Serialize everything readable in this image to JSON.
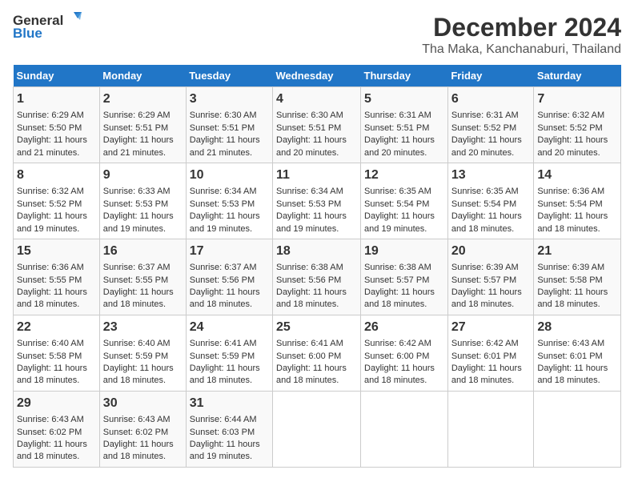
{
  "logo": {
    "line1": "General",
    "line2": "Blue"
  },
  "title": "December 2024",
  "subtitle": "Tha Maka, Kanchanaburi, Thailand",
  "headers": [
    "Sunday",
    "Monday",
    "Tuesday",
    "Wednesday",
    "Thursday",
    "Friday",
    "Saturday"
  ],
  "weeks": [
    [
      {
        "day": "1",
        "sunrise": "Sunrise: 6:29 AM",
        "sunset": "Sunset: 5:50 PM",
        "daylight": "Daylight: 11 hours and 21 minutes."
      },
      {
        "day": "2",
        "sunrise": "Sunrise: 6:29 AM",
        "sunset": "Sunset: 5:51 PM",
        "daylight": "Daylight: 11 hours and 21 minutes."
      },
      {
        "day": "3",
        "sunrise": "Sunrise: 6:30 AM",
        "sunset": "Sunset: 5:51 PM",
        "daylight": "Daylight: 11 hours and 21 minutes."
      },
      {
        "day": "4",
        "sunrise": "Sunrise: 6:30 AM",
        "sunset": "Sunset: 5:51 PM",
        "daylight": "Daylight: 11 hours and 20 minutes."
      },
      {
        "day": "5",
        "sunrise": "Sunrise: 6:31 AM",
        "sunset": "Sunset: 5:51 PM",
        "daylight": "Daylight: 11 hours and 20 minutes."
      },
      {
        "day": "6",
        "sunrise": "Sunrise: 6:31 AM",
        "sunset": "Sunset: 5:52 PM",
        "daylight": "Daylight: 11 hours and 20 minutes."
      },
      {
        "day": "7",
        "sunrise": "Sunrise: 6:32 AM",
        "sunset": "Sunset: 5:52 PM",
        "daylight": "Daylight: 11 hours and 20 minutes."
      }
    ],
    [
      {
        "day": "8",
        "sunrise": "Sunrise: 6:32 AM",
        "sunset": "Sunset: 5:52 PM",
        "daylight": "Daylight: 11 hours and 19 minutes."
      },
      {
        "day": "9",
        "sunrise": "Sunrise: 6:33 AM",
        "sunset": "Sunset: 5:53 PM",
        "daylight": "Daylight: 11 hours and 19 minutes."
      },
      {
        "day": "10",
        "sunrise": "Sunrise: 6:34 AM",
        "sunset": "Sunset: 5:53 PM",
        "daylight": "Daylight: 11 hours and 19 minutes."
      },
      {
        "day": "11",
        "sunrise": "Sunrise: 6:34 AM",
        "sunset": "Sunset: 5:53 PM",
        "daylight": "Daylight: 11 hours and 19 minutes."
      },
      {
        "day": "12",
        "sunrise": "Sunrise: 6:35 AM",
        "sunset": "Sunset: 5:54 PM",
        "daylight": "Daylight: 11 hours and 19 minutes."
      },
      {
        "day": "13",
        "sunrise": "Sunrise: 6:35 AM",
        "sunset": "Sunset: 5:54 PM",
        "daylight": "Daylight: 11 hours and 18 minutes."
      },
      {
        "day": "14",
        "sunrise": "Sunrise: 6:36 AM",
        "sunset": "Sunset: 5:54 PM",
        "daylight": "Daylight: 11 hours and 18 minutes."
      }
    ],
    [
      {
        "day": "15",
        "sunrise": "Sunrise: 6:36 AM",
        "sunset": "Sunset: 5:55 PM",
        "daylight": "Daylight: 11 hours and 18 minutes."
      },
      {
        "day": "16",
        "sunrise": "Sunrise: 6:37 AM",
        "sunset": "Sunset: 5:55 PM",
        "daylight": "Daylight: 11 hours and 18 minutes."
      },
      {
        "day": "17",
        "sunrise": "Sunrise: 6:37 AM",
        "sunset": "Sunset: 5:56 PM",
        "daylight": "Daylight: 11 hours and 18 minutes."
      },
      {
        "day": "18",
        "sunrise": "Sunrise: 6:38 AM",
        "sunset": "Sunset: 5:56 PM",
        "daylight": "Daylight: 11 hours and 18 minutes."
      },
      {
        "day": "19",
        "sunrise": "Sunrise: 6:38 AM",
        "sunset": "Sunset: 5:57 PM",
        "daylight": "Daylight: 11 hours and 18 minutes."
      },
      {
        "day": "20",
        "sunrise": "Sunrise: 6:39 AM",
        "sunset": "Sunset: 5:57 PM",
        "daylight": "Daylight: 11 hours and 18 minutes."
      },
      {
        "day": "21",
        "sunrise": "Sunrise: 6:39 AM",
        "sunset": "Sunset: 5:58 PM",
        "daylight": "Daylight: 11 hours and 18 minutes."
      }
    ],
    [
      {
        "day": "22",
        "sunrise": "Sunrise: 6:40 AM",
        "sunset": "Sunset: 5:58 PM",
        "daylight": "Daylight: 11 hours and 18 minutes."
      },
      {
        "day": "23",
        "sunrise": "Sunrise: 6:40 AM",
        "sunset": "Sunset: 5:59 PM",
        "daylight": "Daylight: 11 hours and 18 minutes."
      },
      {
        "day": "24",
        "sunrise": "Sunrise: 6:41 AM",
        "sunset": "Sunset: 5:59 PM",
        "daylight": "Daylight: 11 hours and 18 minutes."
      },
      {
        "day": "25",
        "sunrise": "Sunrise: 6:41 AM",
        "sunset": "Sunset: 6:00 PM",
        "daylight": "Daylight: 11 hours and 18 minutes."
      },
      {
        "day": "26",
        "sunrise": "Sunrise: 6:42 AM",
        "sunset": "Sunset: 6:00 PM",
        "daylight": "Daylight: 11 hours and 18 minutes."
      },
      {
        "day": "27",
        "sunrise": "Sunrise: 6:42 AM",
        "sunset": "Sunset: 6:01 PM",
        "daylight": "Daylight: 11 hours and 18 minutes."
      },
      {
        "day": "28",
        "sunrise": "Sunrise: 6:43 AM",
        "sunset": "Sunset: 6:01 PM",
        "daylight": "Daylight: 11 hours and 18 minutes."
      }
    ],
    [
      {
        "day": "29",
        "sunrise": "Sunrise: 6:43 AM",
        "sunset": "Sunset: 6:02 PM",
        "daylight": "Daylight: 11 hours and 18 minutes."
      },
      {
        "day": "30",
        "sunrise": "Sunrise: 6:43 AM",
        "sunset": "Sunset: 6:02 PM",
        "daylight": "Daylight: 11 hours and 18 minutes."
      },
      {
        "day": "31",
        "sunrise": "Sunrise: 6:44 AM",
        "sunset": "Sunset: 6:03 PM",
        "daylight": "Daylight: 11 hours and 19 minutes."
      },
      null,
      null,
      null,
      null
    ]
  ]
}
